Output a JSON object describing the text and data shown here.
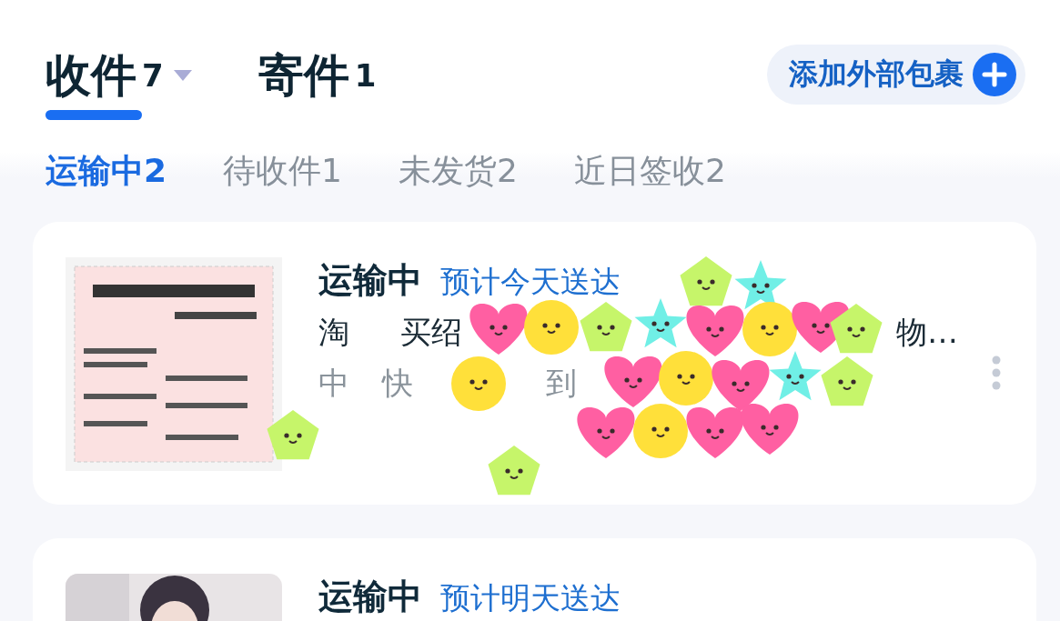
{
  "header": {
    "tabs": [
      {
        "label": "收件",
        "count": "7",
        "selected": true,
        "dropdown": true
      },
      {
        "label": "寄件",
        "count": "1",
        "selected": false,
        "dropdown": false
      }
    ],
    "add_button": {
      "label": "添加外部包裹"
    }
  },
  "filters": [
    {
      "label": "运输中",
      "count": "2",
      "selected": true
    },
    {
      "label": "待收件",
      "count": "1",
      "selected": false
    },
    {
      "label": "未发货",
      "count": "2",
      "selected": false
    },
    {
      "label": "近日签收",
      "count": "2",
      "selected": false
    }
  ],
  "packages": [
    {
      "status": "运输中",
      "eta": "预计今天送达",
      "title_fragments": [
        "淘",
        "买绍",
        "物…"
      ],
      "detail_fragments": [
        "中",
        "快",
        "到"
      ],
      "thumbnail": {
        "kind": "picture"
      },
      "overlay": {
        "kind": "stickers"
      }
    },
    {
      "status": "运输中",
      "eta": "预计明天送达",
      "thumbnail": {
        "kind": "picture"
      }
    }
  ]
}
